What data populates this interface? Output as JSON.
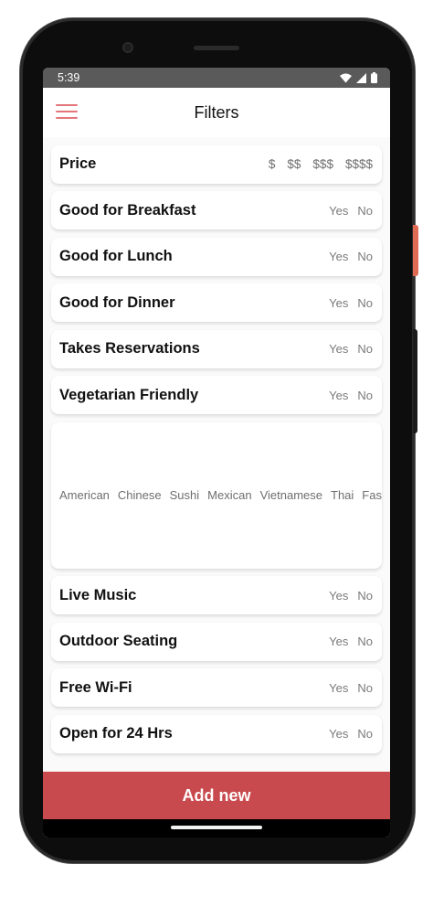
{
  "status": {
    "time": "5:39"
  },
  "app": {
    "title": "Filters"
  },
  "price": {
    "label": "Price",
    "options": [
      "$",
      "$$",
      "$$$",
      "$$$$"
    ]
  },
  "filters_top": [
    {
      "label": "Good for Breakfast",
      "yes": "Yes",
      "no": "No"
    },
    {
      "label": "Good for Lunch",
      "yes": "Yes",
      "no": "No"
    },
    {
      "label": "Good for Dinner",
      "yes": "Yes",
      "no": "No"
    },
    {
      "label": "Takes Reservations",
      "yes": "Yes",
      "no": "No"
    },
    {
      "label": "Vegetarian Friendly",
      "yes": "Yes",
      "no": "No"
    }
  ],
  "cuisines": [
    "American",
    "Chinese",
    "Sushi",
    "Mexican",
    "Vietnamese",
    "Thai",
    "Fas"
  ],
  "filters_bottom": [
    {
      "label": "Live Music",
      "yes": "Yes",
      "no": "No"
    },
    {
      "label": "Outdoor Seating",
      "yes": "Yes",
      "no": "No"
    },
    {
      "label": "Free Wi-Fi",
      "yes": "Yes",
      "no": "No"
    },
    {
      "label": "Open for 24 Hrs",
      "yes": "Yes",
      "no": "No"
    }
  ],
  "actions": {
    "add_new": "Add new"
  },
  "colors": {
    "accent": "#c8494e",
    "menu_icon": "#e3757b",
    "status_bar": "#5a5a5a"
  }
}
